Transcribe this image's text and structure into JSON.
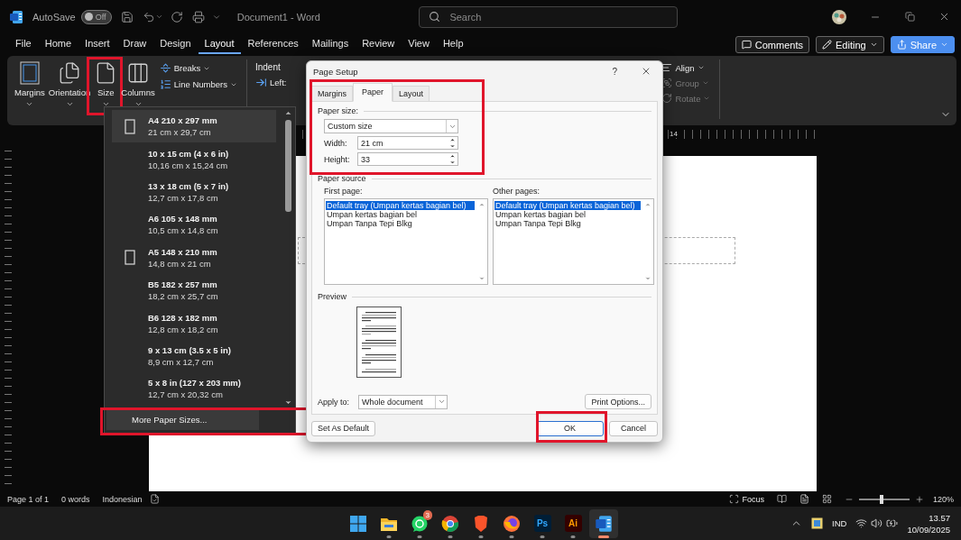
{
  "titlebar": {
    "autosave_label": "AutoSave",
    "autosave": {
      "on": false,
      "label": "Off"
    },
    "title": "Document1  -  Word",
    "search": {
      "placeholder": "Search"
    }
  },
  "menu_tabs": [
    {
      "label": "File",
      "selected": false
    },
    {
      "label": "Home",
      "selected": false
    },
    {
      "label": "Insert",
      "selected": false
    },
    {
      "label": "Draw",
      "selected": false
    },
    {
      "label": "Design",
      "selected": false
    },
    {
      "label": "Layout",
      "selected": true
    },
    {
      "label": "References",
      "selected": false
    },
    {
      "label": "Mailings",
      "selected": false
    },
    {
      "label": "Review",
      "selected": false
    },
    {
      "label": "View",
      "selected": false
    },
    {
      "label": "Help",
      "selected": false
    }
  ],
  "actions": [
    {
      "label": "Comments",
      "kind": "comments"
    },
    {
      "label": "Editing",
      "kind": "editing"
    },
    {
      "label": "Share",
      "kind": "share"
    }
  ],
  "ribbon": {
    "large_buttons": [
      {
        "label": "Margins",
        "kind": "margins",
        "highlighted": false
      },
      {
        "label": "Orientation",
        "kind": "orientation",
        "highlighted": false
      },
      {
        "label": "Size",
        "kind": "size",
        "highlighted": true
      },
      {
        "label": "Columns",
        "kind": "columns",
        "highlighted": false
      }
    ],
    "small_buttons": [
      {
        "label": "Breaks",
        "kind": "breaks"
      },
      {
        "label": "Line Numbers",
        "kind": "line-numbers"
      }
    ],
    "indent": {
      "title": "Indent",
      "left_label": "Left:"
    },
    "arrange": [
      {
        "label": "Align",
        "kind": "align",
        "disabled": false
      },
      {
        "label": "Group",
        "kind": "group",
        "disabled": true
      },
      {
        "label": "Rotate",
        "kind": "rotate",
        "disabled": true
      }
    ]
  },
  "ruler": {
    "label": "14"
  },
  "size_menu": {
    "items": [
      {
        "name": "A4 210 x 297 mm",
        "size": "21 cm x 29,7 cm",
        "selected": true,
        "icon": true
      },
      {
        "name": "10 x 15 cm (4 x 6 in)",
        "size": "10,16 cm x 15,24 cm",
        "selected": false,
        "icon": false
      },
      {
        "name": "13 x 18 cm (5 x 7 in)",
        "size": "12,7 cm x 17,8 cm",
        "selected": false,
        "icon": false
      },
      {
        "name": "A6 105 x 148 mm",
        "size": "10,5 cm x 14,8 cm",
        "selected": false,
        "icon": false
      },
      {
        "name": "A5 148 x 210 mm",
        "size": "14,8 cm x 21 cm",
        "selected": false,
        "icon": true
      },
      {
        "name": "B5 182 x 257 mm",
        "size": "18,2 cm x 25,7 cm",
        "selected": false,
        "icon": false
      },
      {
        "name": "B6 128 x 182 mm",
        "size": "12,8 cm x 18,2 cm",
        "selected": false,
        "icon": false
      },
      {
        "name": "9 x 13 cm (3.5 x 5 in)",
        "size": "8,9 cm x 12,7 cm",
        "selected": false,
        "icon": false
      },
      {
        "name": "5 x 8 in (127 x 203 mm)",
        "size": "12,7 cm x 20,32 cm",
        "selected": false,
        "icon": false
      }
    ],
    "more": {
      "label": "More Paper Sizes...",
      "highlighted": true
    }
  },
  "dialog": {
    "title": "Page Setup",
    "help": "?",
    "tabs": [
      {
        "label": "Margins",
        "selected": false
      },
      {
        "label": "Paper",
        "selected": true
      },
      {
        "label": "Layout",
        "selected": false
      }
    ],
    "paper_size": {
      "label": "Paper size:",
      "value": "Custom size",
      "highlighted": true
    },
    "width": {
      "label": "Width:",
      "value": "21 cm"
    },
    "height": {
      "label": "Height:",
      "value": "33"
    },
    "paper_source": {
      "label": "Paper source",
      "lists": [
        {
          "label": "First page:",
          "items": [
            {
              "text": "Default tray (Umpan kertas bagian bel)",
              "selected": true
            },
            {
              "text": "Umpan kertas bagian bel",
              "selected": false
            },
            {
              "text": "Umpan Tanpa Tepi Blkg",
              "selected": false
            }
          ]
        },
        {
          "label": "Other pages:",
          "items": [
            {
              "text": "Default tray (Umpan kertas bagian bel)",
              "selected": true
            },
            {
              "text": "Umpan kertas bagian bel",
              "selected": false
            },
            {
              "text": "Umpan Tanpa Tepi Blkg",
              "selected": false
            }
          ]
        }
      ]
    },
    "preview_label": "Preview",
    "apply_to": {
      "label": "Apply to:",
      "value": "Whole document"
    },
    "print_options": "Print Options...",
    "set_default": "Set As Default",
    "ok": {
      "label": "OK",
      "highlighted": true
    },
    "cancel": "Cancel"
  },
  "status_bar": {
    "page": "Page 1 of 1",
    "words": "0 words",
    "language": "Indonesian",
    "focus": "Focus",
    "zoom_slider": {
      "level": 0.45
    },
    "zoom": "120%"
  },
  "taskbar": {
    "apps": [
      {
        "kind": "start",
        "running": false,
        "selected": false
      },
      {
        "kind": "explorer",
        "running": true,
        "selected": false
      },
      {
        "kind": "whatsapp",
        "badge": "3",
        "running": true,
        "selected": false
      },
      {
        "kind": "chrome",
        "running": true,
        "selected": false
      },
      {
        "kind": "brave",
        "running": true,
        "selected": false
      },
      {
        "kind": "firefox",
        "running": true,
        "selected": false
      },
      {
        "kind": "photoshop",
        "label": "Ps",
        "running": true,
        "selected": false
      },
      {
        "kind": "illustrator",
        "label": "Ai",
        "running": true,
        "selected": false
      },
      {
        "kind": "word",
        "running": true,
        "selected": true
      }
    ],
    "language": "IND",
    "time": "13.57",
    "date": "10/09/2025"
  }
}
